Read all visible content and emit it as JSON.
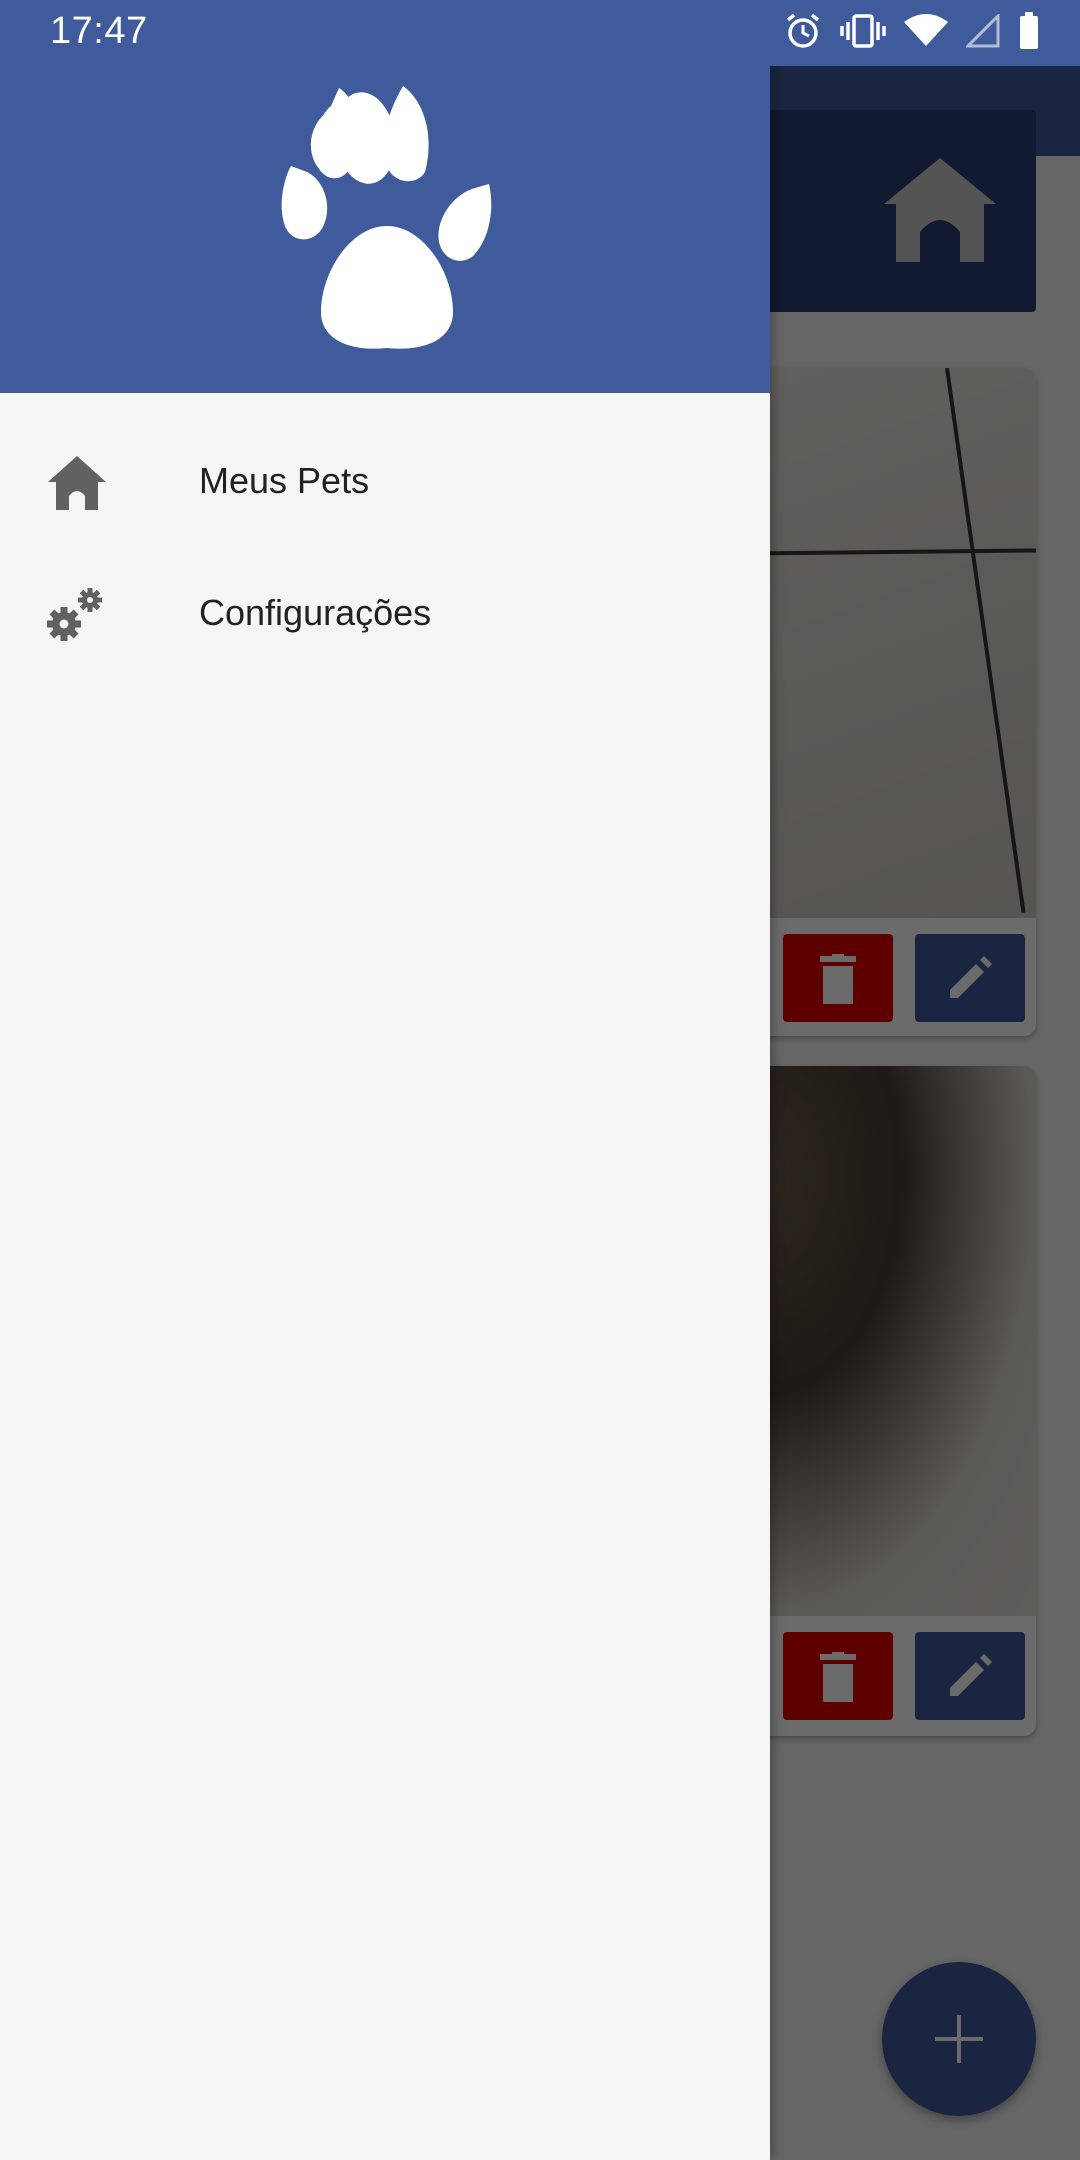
{
  "status_bar": {
    "time": "17:47",
    "icons": [
      "alarm-icon",
      "vibrate-icon",
      "wifi-icon",
      "signal-icon",
      "battery-icon"
    ]
  },
  "drawer": {
    "header_icon": "paw-icon",
    "items": [
      {
        "label": "Meus Pets",
        "icon": "home-icon"
      },
      {
        "label": "Configurações",
        "icon": "settings-gears-icon"
      }
    ]
  },
  "background_screen": {
    "header_icon": "doghouse-icon",
    "cards": [
      {
        "actions": [
          "delete-icon",
          "edit-icon"
        ]
      },
      {
        "actions": [
          "delete-icon",
          "edit-icon"
        ]
      }
    ],
    "fab_icon": "add-icon"
  },
  "colors": {
    "primary": "#3f5b9c",
    "delete": "#e00000",
    "drawer_bg": "#f5f5f5",
    "text": "#212121",
    "icon_gray": "#616161"
  }
}
